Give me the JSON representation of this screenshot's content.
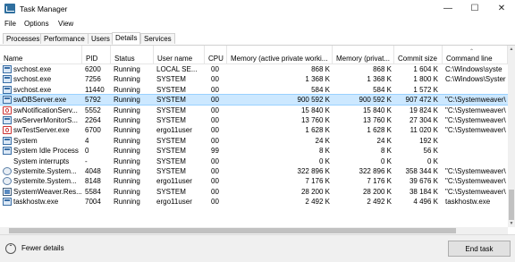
{
  "window": {
    "title": "Task Manager",
    "minimize": "—",
    "maximize": "☐",
    "close": "✕"
  },
  "menu": [
    "File",
    "Options",
    "View"
  ],
  "tabs": [
    {
      "label": "Processes",
      "active": false
    },
    {
      "label": "Performance",
      "active": false
    },
    {
      "label": "Users",
      "active": false
    },
    {
      "label": "Details",
      "active": true
    },
    {
      "label": "Services",
      "active": false
    }
  ],
  "columns": [
    "Name",
    "PID",
    "Status",
    "User name",
    "CPU",
    "Memory (active private worki...",
    "Memory (privat...",
    "Commit size",
    "Command line"
  ],
  "rows": [
    {
      "icon": "blue",
      "name": "svchost.exe",
      "pid": "6200",
      "status": "Running",
      "user": "LOCAL SE...",
      "cpu": "00",
      "mem_active": "868 K",
      "mem_private": "868 K",
      "commit": "1 604 K",
      "cmd": "C:\\Windows\\syste",
      "selected": false
    },
    {
      "icon": "blue",
      "name": "svchost.exe",
      "pid": "7256",
      "status": "Running",
      "user": "SYSTEM",
      "cpu": "00",
      "mem_active": "1 368 K",
      "mem_private": "1 368 K",
      "commit": "1 800 K",
      "cmd": "C:\\Windows\\Syster",
      "selected": false
    },
    {
      "icon": "blue",
      "name": "svchost.exe",
      "pid": "11440",
      "status": "Running",
      "user": "SYSTEM",
      "cpu": "00",
      "mem_active": "584 K",
      "mem_private": "584 K",
      "commit": "1 572 K",
      "cmd": "",
      "selected": false
    },
    {
      "icon": "blue",
      "name": "swDBServer.exe",
      "pid": "5792",
      "status": "Running",
      "user": "SYSTEM",
      "cpu": "00",
      "mem_active": "900 592 K",
      "mem_private": "900 592 K",
      "commit": "907 472 K",
      "cmd": "\"C:\\Systemweaver\\",
      "selected": true
    },
    {
      "icon": "red",
      "name": "swNotificationServ...",
      "pid": "5552",
      "status": "Running",
      "user": "SYSTEM",
      "cpu": "00",
      "mem_active": "15 840 K",
      "mem_private": "15 840 K",
      "commit": "19 824 K",
      "cmd": "\"C:\\Systemweaver\\",
      "selected": false
    },
    {
      "icon": "blue",
      "name": "swServerMonitorS...",
      "pid": "2264",
      "status": "Running",
      "user": "SYSTEM",
      "cpu": "00",
      "mem_active": "13 760 K",
      "mem_private": "13 760 K",
      "commit": "27 304 K",
      "cmd": "\"C:\\Systemweaver\\",
      "selected": false
    },
    {
      "icon": "red",
      "name": "swTestServer.exe",
      "pid": "6700",
      "status": "Running",
      "user": "ergo11user",
      "cpu": "00",
      "mem_active": "1 628 K",
      "mem_private": "1 628 K",
      "commit": "11 020 K",
      "cmd": "\"C:\\Systemweaver\\",
      "selected": false
    },
    {
      "icon": "blue",
      "name": "System",
      "pid": "4",
      "status": "Running",
      "user": "SYSTEM",
      "cpu": "00",
      "mem_active": "24 K",
      "mem_private": "24 K",
      "commit": "192 K",
      "cmd": "",
      "selected": false
    },
    {
      "icon": "blue",
      "name": "System Idle Process",
      "pid": "0",
      "status": "Running",
      "user": "SYSTEM",
      "cpu": "99",
      "mem_active": "8 K",
      "mem_private": "8 K",
      "commit": "56 K",
      "cmd": "",
      "selected": false
    },
    {
      "icon": "none",
      "name": "System interrupts",
      "pid": "-",
      "status": "Running",
      "user": "SYSTEM",
      "cpu": "00",
      "mem_active": "0 K",
      "mem_private": "0 K",
      "commit": "0 K",
      "cmd": "",
      "selected": false
    },
    {
      "icon": "gear",
      "name": "Systemite.System...",
      "pid": "4048",
      "status": "Running",
      "user": "SYSTEM",
      "cpu": "00",
      "mem_active": "322 896 K",
      "mem_private": "322 896 K",
      "commit": "358 344 K",
      "cmd": "\"C:\\Systemweaver\\",
      "selected": false
    },
    {
      "icon": "gear",
      "name": "Systemite.System...",
      "pid": "8148",
      "status": "Running",
      "user": "ergo11user",
      "cpu": "00",
      "mem_active": "7 176 K",
      "mem_private": "7 176 K",
      "commit": "39 676 K",
      "cmd": "\"C:\\Systemweaver\\",
      "selected": false
    },
    {
      "icon": "dark",
      "name": "SystemWeaver.Res...",
      "pid": "5584",
      "status": "Running",
      "user": "SYSTEM",
      "cpu": "00",
      "mem_active": "28 200 K",
      "mem_private": "28 200 K",
      "commit": "38 184 K",
      "cmd": "\"C:\\Systemweaver\\",
      "selected": false
    },
    {
      "icon": "blue",
      "name": "taskhostw.exe",
      "pid": "7004",
      "status": "Running",
      "user": "ergo11user",
      "cpu": "00",
      "mem_active": "2 492 K",
      "mem_private": "2 492 K",
      "commit": "4 496 K",
      "cmd": "taskhostw.exe",
      "selected": false
    }
  ],
  "footer": {
    "fewer_details": "Fewer details",
    "fewer_icon": "⌃",
    "end_task": "End task"
  },
  "scroll": {
    "up": "▲",
    "down": "▼"
  }
}
